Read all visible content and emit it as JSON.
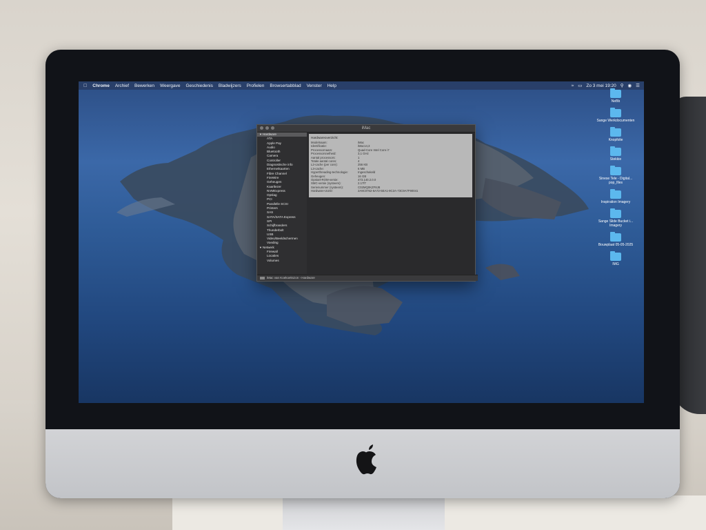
{
  "menubar": {
    "apple_menu": "",
    "app_name": "Chrome",
    "items": [
      "Archief",
      "Bewerken",
      "Weergave",
      "Geschiedenis",
      "Bladwijzers",
      "Profielen",
      "Browsertabblad",
      "Venster",
      "Help"
    ],
    "clock": "Zo 3 mei 19:20"
  },
  "desktop_icons": [
    {
      "label": "NeBb"
    },
    {
      "label": "Sange Werkdocumenten"
    },
    {
      "label": "Knopfolie"
    },
    {
      "label": "Stekkie"
    },
    {
      "label": "Sinese Tele - Digital... pop_files"
    },
    {
      "label": "Inspiration Imagery"
    },
    {
      "label": "Sange Slide Bucket i... Imagery"
    },
    {
      "label": "Bouwplaat 05-05-2025"
    },
    {
      "label": "IMG"
    }
  ],
  "window": {
    "title": "iMac",
    "sidebar": [
      {
        "label": "Hardware",
        "section": true,
        "selected": true
      },
      {
        "label": "ATA"
      },
      {
        "label": "Apple Pay"
      },
      {
        "label": "Audio"
      },
      {
        "label": "Bluetooth"
      },
      {
        "label": "Camera"
      },
      {
        "label": "Controller"
      },
      {
        "label": "Diagnostische info"
      },
      {
        "label": "Ethernetkaarten"
      },
      {
        "label": "Fibre Channel"
      },
      {
        "label": "FireWire"
      },
      {
        "label": "Geheugen"
      },
      {
        "label": "Kaartlezer"
      },
      {
        "label": "NVMExpress"
      },
      {
        "label": "Opslag"
      },
      {
        "label": "PCI"
      },
      {
        "label": "Parallelle SCSI"
      },
      {
        "label": "Printers"
      },
      {
        "label": "SAS"
      },
      {
        "label": "SATA/SATA Express"
      },
      {
        "label": "SPI"
      },
      {
        "label": "Schijfbranders"
      },
      {
        "label": "Thunderbolt"
      },
      {
        "label": "USB"
      },
      {
        "label": "Video/Beeldschermen"
      },
      {
        "label": "Voeding"
      },
      {
        "label": "Netwerk",
        "section": true
      },
      {
        "label": "Firewall"
      },
      {
        "label": "Locaties"
      },
      {
        "label": "Volumes"
      }
    ],
    "content_heading": "Hardwareoverzicht:",
    "rows": [
      {
        "k": "Modelnaam:",
        "v": "iMac"
      },
      {
        "k": "Identificatie:",
        "v": "iMac14,3"
      },
      {
        "k": "Processornaam:",
        "v": "Quad-Core Intel Core i7"
      },
      {
        "k": "Processorsnelheid:",
        "v": "3,1 GHz"
      },
      {
        "k": "Aantal processors:",
        "v": "1"
      },
      {
        "k": "Totale aantal cores:",
        "v": "4"
      },
      {
        "k": "L2-cache (per core):",
        "v": "256 KB"
      },
      {
        "k": "L3-cache:",
        "v": "6 MB"
      },
      {
        "k": "Hyperthreading-technologie:",
        "v": "Ingeschakeld"
      },
      {
        "k": "Geheugen:",
        "v": "16 GB"
      },
      {
        "k": "Opstart-ROM-versie:",
        "v": "473.140.2.0.0"
      },
      {
        "k": "SMC-versie (systeem):",
        "v": "2.17f7"
      },
      {
        "k": "Serienummer (systeem):",
        "v": "C02MQ0KZF8J8"
      },
      {
        "k": "Hardware-UUID:",
        "v": "2A9C0762-5A72-5EA1-9C2A-73C9A7F90041"
      }
    ],
    "status": "iMac van Koekoekszon › Hardware"
  },
  "colors": {
    "folder": "#5cb8ee",
    "window_bg": "#2b2b2d",
    "panel_bg": "#b8b8b8"
  }
}
